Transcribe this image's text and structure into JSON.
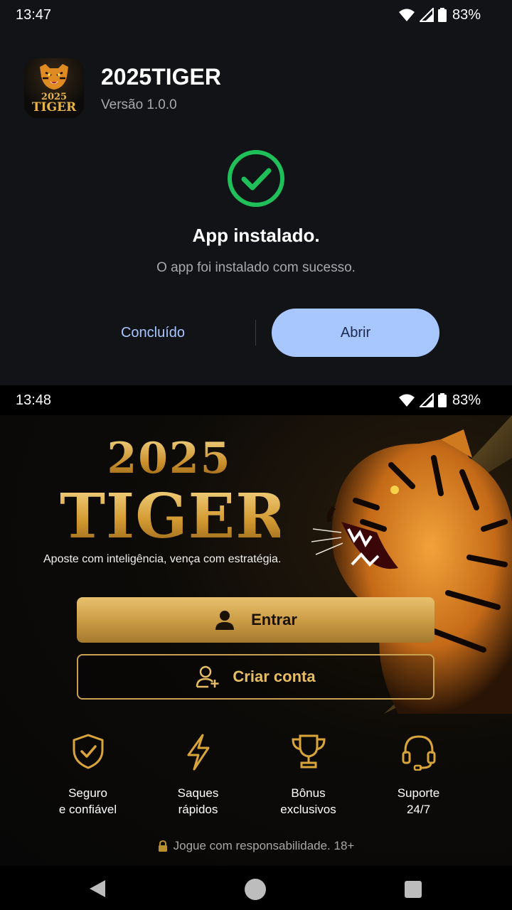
{
  "install_screen": {
    "status": {
      "time": "13:47",
      "battery": "83%"
    },
    "app": {
      "name": "2025TIGER",
      "version": "Versão 1.0.0",
      "icon_year": "2025",
      "icon_text": "TIGER"
    },
    "title": "App instalado.",
    "subtitle": "O app foi instalado com sucesso.",
    "done_label": "Concluído",
    "open_label": "Abrir"
  },
  "landing": {
    "status": {
      "time": "13:48",
      "battery": "83%"
    },
    "brand_year": "2025",
    "brand_name": "TIGER",
    "tagline": "Aposte com inteligência, vença com estratégia.",
    "login_label": "Entrar",
    "signup_label": "Criar conta",
    "features": [
      {
        "icon": "shield-check-icon",
        "line1": "Seguro",
        "line2": "e confiável"
      },
      {
        "icon": "lightning-icon",
        "line1": "Saques",
        "line2": "rápidos"
      },
      {
        "icon": "trophy-icon",
        "line1": "Bônus",
        "line2": "exclusivos"
      },
      {
        "icon": "headset-icon",
        "line1": "Suporte",
        "line2": "24/7"
      }
    ],
    "responsible": "Jogue com responsabilidade. 18+"
  },
  "colors": {
    "accent_blue": "#a9c7ff",
    "success_green": "#1fbf5a",
    "gold": "#d9a53a"
  }
}
